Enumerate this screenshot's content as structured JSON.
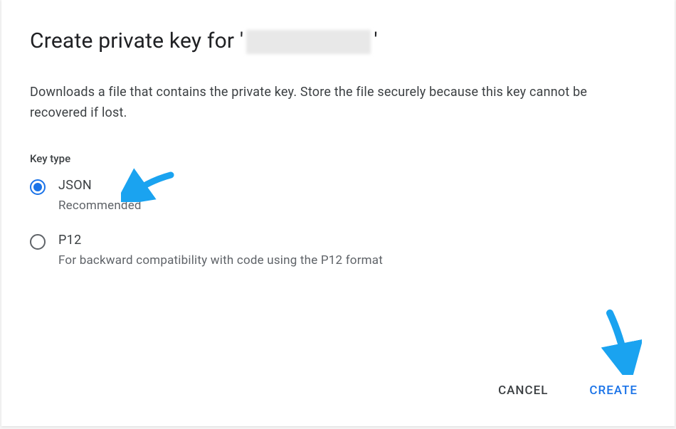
{
  "dialog": {
    "title_prefix": "Create private key for '",
    "title_suffix": "'",
    "description": "Downloads a file that contains the private key. Store the file securely because this key cannot be recovered if lost.",
    "key_type_label": "Key type",
    "options": [
      {
        "label": "JSON",
        "description": "Recommended",
        "selected": true
      },
      {
        "label": "P12",
        "description": "For backward compatibility with code using the P12 format",
        "selected": false
      }
    ],
    "actions": {
      "cancel_label": "CANCEL",
      "create_label": "CREATE"
    }
  },
  "colors": {
    "accent": "#1a73e8",
    "annotation_arrow": "#1aa3f0"
  }
}
